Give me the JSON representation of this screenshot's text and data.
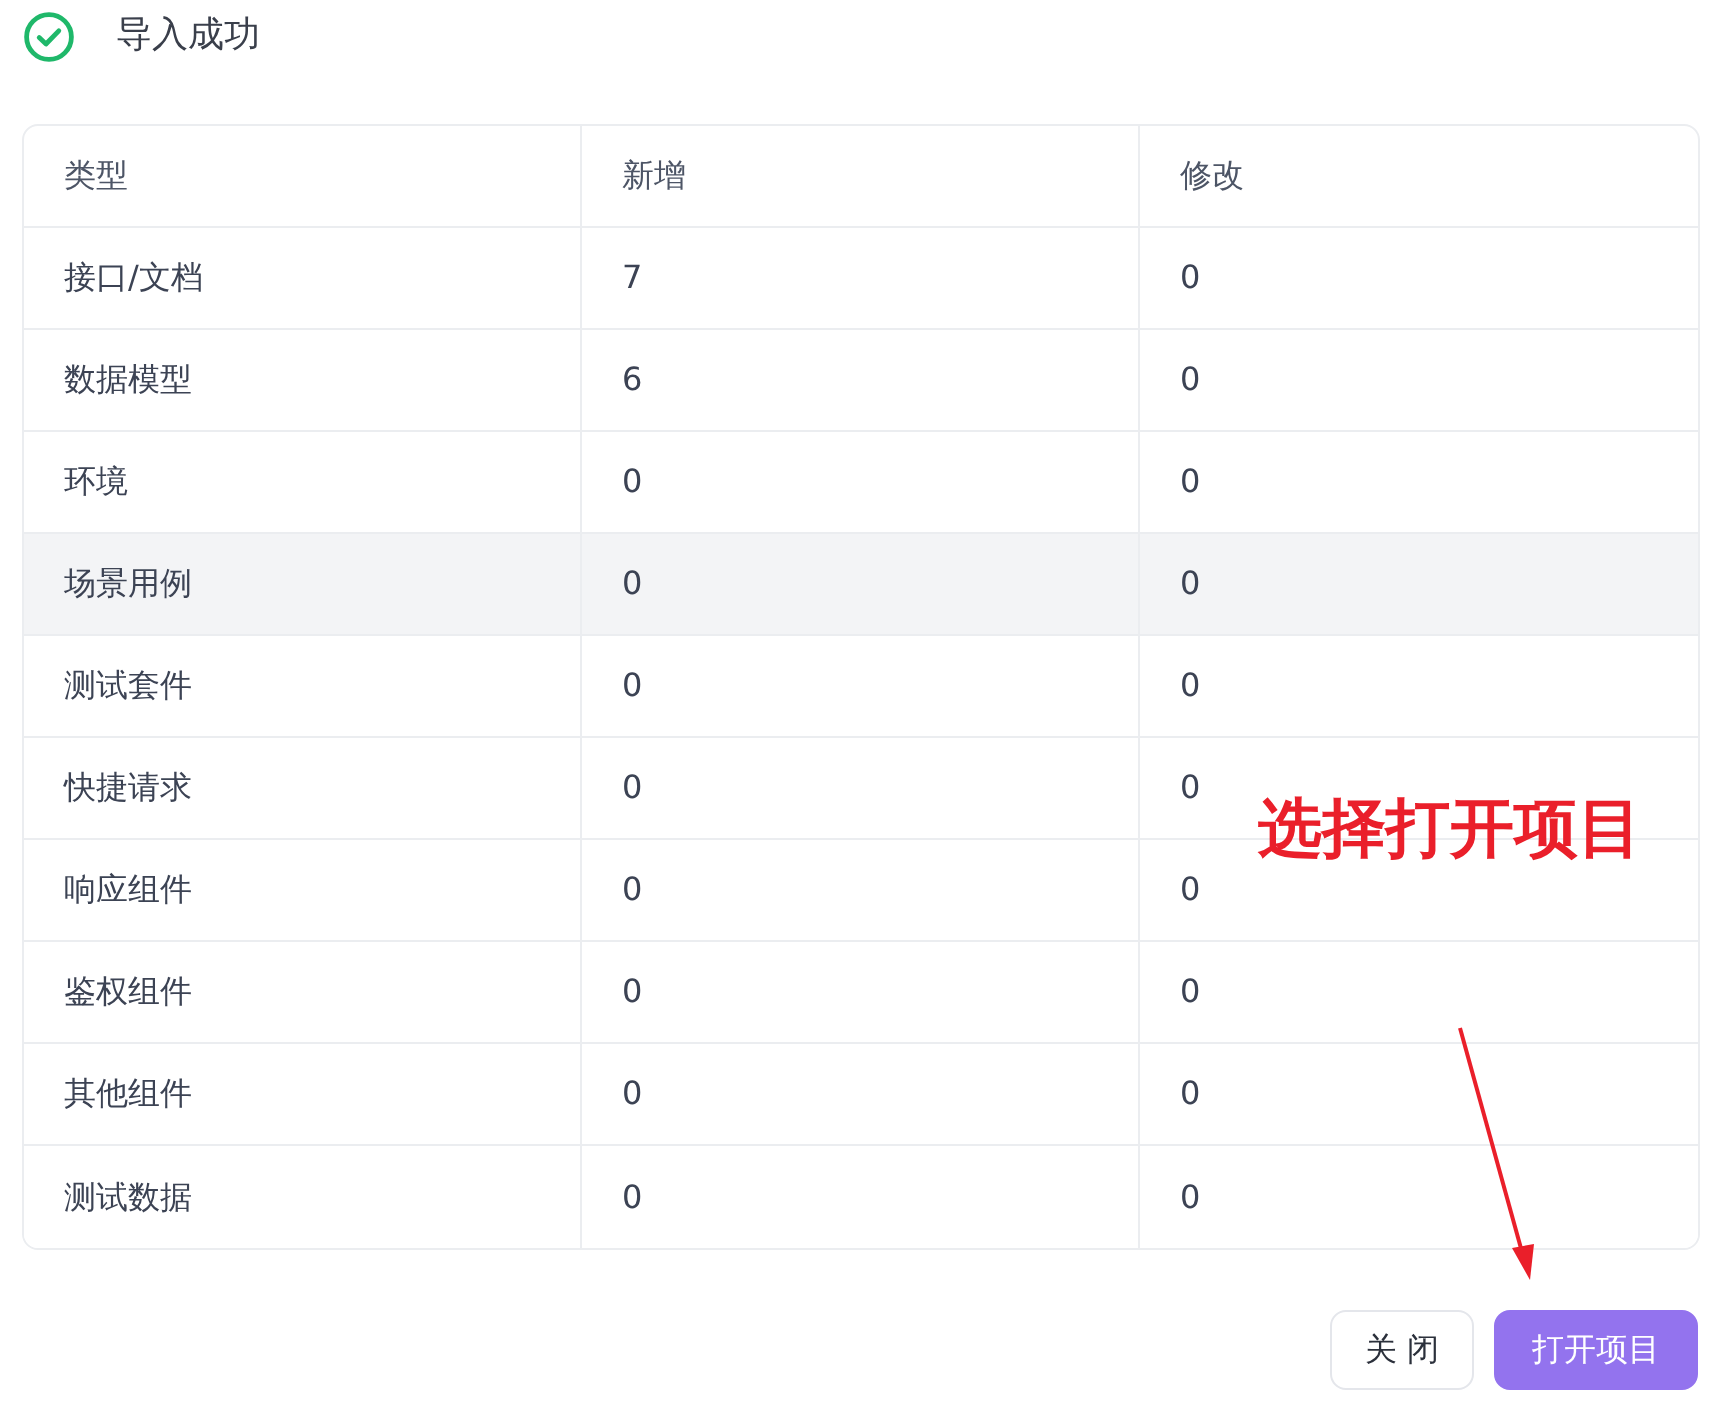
{
  "header": {
    "title": "导入成功"
  },
  "table": {
    "columns": [
      "类型",
      "新增",
      "修改"
    ],
    "rows": [
      {
        "cells": [
          "接口/文档",
          "7",
          "0"
        ],
        "highlighted": false
      },
      {
        "cells": [
          "数据模型",
          "6",
          "0"
        ],
        "highlighted": false
      },
      {
        "cells": [
          "环境",
          "0",
          "0"
        ],
        "highlighted": false
      },
      {
        "cells": [
          "场景用例",
          "0",
          "0"
        ],
        "highlighted": true
      },
      {
        "cells": [
          "测试套件",
          "0",
          "0"
        ],
        "highlighted": false
      },
      {
        "cells": [
          "快捷请求",
          "0",
          "0"
        ],
        "highlighted": false
      },
      {
        "cells": [
          "响应组件",
          "0",
          "0"
        ],
        "highlighted": false
      },
      {
        "cells": [
          "鉴权组件",
          "0",
          "0"
        ],
        "highlighted": false
      },
      {
        "cells": [
          "其他组件",
          "0",
          "0"
        ],
        "highlighted": false
      },
      {
        "cells": [
          "测试数据",
          "0",
          "0"
        ],
        "highlighted": false
      }
    ]
  },
  "annotation": {
    "text": "选择打开项目"
  },
  "buttons": [
    {
      "label": "关 闭",
      "kind": "secondary"
    },
    {
      "label": "打开项目",
      "kind": "primary"
    }
  ]
}
